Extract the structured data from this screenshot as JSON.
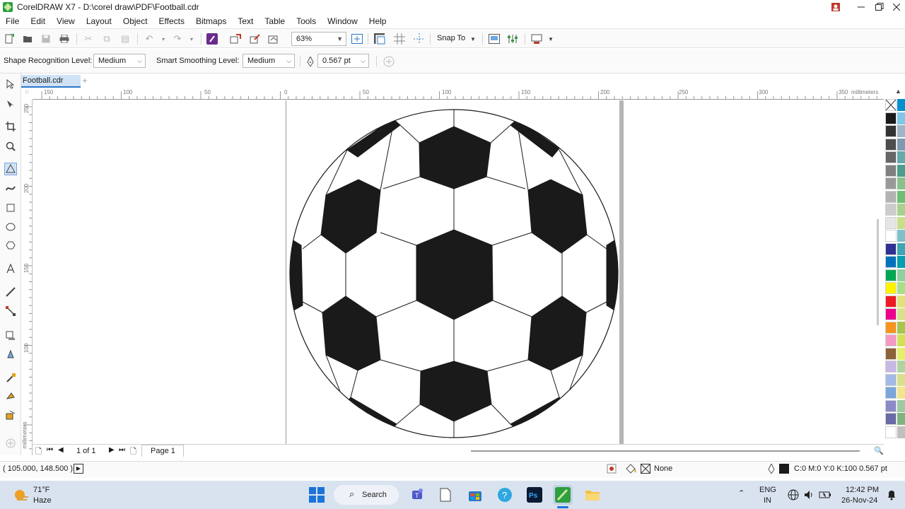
{
  "window": {
    "title": "CorelDRAW X7 - D:\\corel draw\\PDF\\Football.cdr"
  },
  "menu": [
    "File",
    "Edit",
    "View",
    "Layout",
    "Object",
    "Effects",
    "Bitmaps",
    "Text",
    "Table",
    "Tools",
    "Window",
    "Help"
  ],
  "toolbar": {
    "zoom": "63%",
    "snap_to": "Snap To"
  },
  "propbar": {
    "shape_recognition_label": "Shape Recognition Level:",
    "shape_recognition_value": "Medium",
    "smart_smoothing_label": "Smart Smoothing Level:",
    "smart_smoothing_value": "Medium",
    "outline_width": "0.567 pt"
  },
  "document": {
    "tab": "Football.cdr"
  },
  "ruler": {
    "h_labels": [
      "150",
      "100",
      "50",
      "0",
      "50",
      "100",
      "150",
      "200",
      "250",
      "300",
      "350"
    ],
    "units": "millimeters",
    "v_labels": [
      "250",
      "200",
      "150",
      "100"
    ]
  },
  "page_nav": {
    "count": "1 of 1",
    "page_tab": "Page 1"
  },
  "status": {
    "coords": "( 105.000, 148.500 )",
    "fill": "None",
    "outline": "C:0 M:0 Y:0 K:100  0.567 pt"
  },
  "palette": {
    "colors": [
      "#ffffff",
      "#1a1a1a",
      "#333333",
      "#4d4d4d",
      "#666666",
      "#808080",
      "#999999",
      "#b3b3b3",
      "#cccccc",
      "#e6e6e6",
      "#ffffff",
      "#2e3192",
      "#0072bc",
      "#00a651",
      "#fff200",
      "#ed1c24",
      "#ec008c",
      "#f7941d",
      "#f49ac2",
      "#8c6239",
      "#c7b8e6",
      "#a3b9e6",
      "#7aa6dc",
      "#8b8bc8",
      "#6a6aa8",
      "#ffffff"
    ],
    "side_colors": [
      "#0090d0",
      "#7fc6ea",
      "#9fb4c7",
      "#7e9ab0",
      "#66aaaa",
      "#4b9d8c",
      "#88c28b",
      "#6dbf73",
      "#a9d18e",
      "#c8de8b",
      "#7fc1c9",
      "#3da6b5",
      "#00a0b0",
      "#8fd0a0",
      "#a8e08a",
      "#e2e27a",
      "#d9e28a",
      "#a6c64d",
      "#d4e157",
      "#e6ee6a",
      "#b0d4a0",
      "#d8e08a",
      "#f0e68c",
      "#9ec9a2",
      "#7fb37f",
      "#c0c0c0"
    ]
  },
  "weather": {
    "temp": "71°F",
    "cond": "Haze"
  },
  "taskbar": {
    "search": "Search"
  },
  "tray": {
    "lang1": "ENG",
    "lang2": "IN",
    "time": "12:42 PM",
    "date": "26-Nov-24"
  }
}
